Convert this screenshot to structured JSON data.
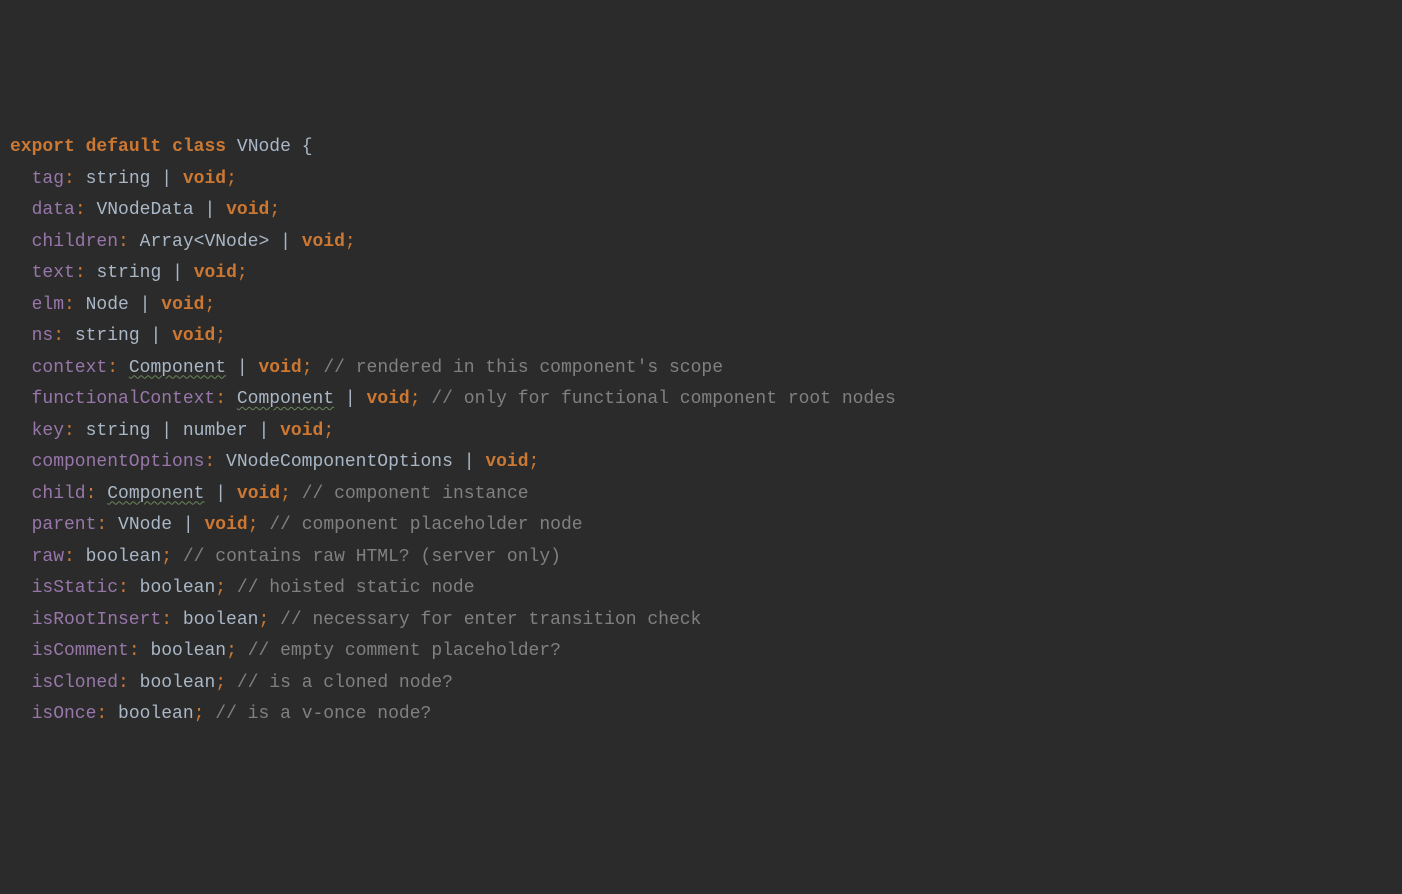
{
  "header": {
    "export": "export",
    "default": "default",
    "class": "class",
    "name": "VNode",
    "brace": "{"
  },
  "props": [
    {
      "name": "tag",
      "types": [
        "string"
      ],
      "void": true,
      "comment": "",
      "squiggle": []
    },
    {
      "name": "data",
      "types": [
        "VNodeData"
      ],
      "void": true,
      "comment": "",
      "squiggle": []
    },
    {
      "name": "children",
      "types": [
        "Array<VNode>"
      ],
      "void": true,
      "comment": "",
      "squiggle": []
    },
    {
      "name": "text",
      "types": [
        "string"
      ],
      "void": true,
      "comment": "",
      "squiggle": []
    },
    {
      "name": "elm",
      "types": [
        "Node"
      ],
      "void": true,
      "comment": "",
      "squiggle": []
    },
    {
      "name": "ns",
      "types": [
        "string"
      ],
      "void": true,
      "comment": "",
      "squiggle": []
    },
    {
      "name": "context",
      "types": [
        "Component"
      ],
      "void": true,
      "comment": "// rendered in this component's scope",
      "squiggle": [
        0
      ]
    },
    {
      "name": "functionalContext",
      "types": [
        "Component"
      ],
      "void": true,
      "comment": "// only for functional component root nodes",
      "squiggle": [
        0
      ]
    },
    {
      "name": "key",
      "types": [
        "string",
        "number"
      ],
      "void": true,
      "comment": "",
      "squiggle": []
    },
    {
      "name": "componentOptions",
      "types": [
        "VNodeComponentOptions"
      ],
      "void": true,
      "comment": "",
      "squiggle": []
    },
    {
      "name": "child",
      "types": [
        "Component"
      ],
      "void": true,
      "comment": "// component instance",
      "squiggle": [
        0
      ]
    },
    {
      "name": "parent",
      "types": [
        "VNode"
      ],
      "void": true,
      "comment": "// component placeholder node",
      "squiggle": []
    },
    {
      "name": "raw",
      "types": [
        "boolean"
      ],
      "void": false,
      "comment": "// contains raw HTML? (server only)",
      "squiggle": []
    },
    {
      "name": "isStatic",
      "types": [
        "boolean"
      ],
      "void": false,
      "comment": "// hoisted static node",
      "squiggle": []
    },
    {
      "name": "isRootInsert",
      "types": [
        "boolean"
      ],
      "void": false,
      "comment": "// necessary for enter transition check",
      "squiggle": []
    },
    {
      "name": "isComment",
      "types": [
        "boolean"
      ],
      "void": false,
      "comment": "// empty comment placeholder?",
      "squiggle": []
    },
    {
      "name": "isCloned",
      "types": [
        "boolean"
      ],
      "void": false,
      "comment": "// is a cloned node?",
      "squiggle": []
    },
    {
      "name": "isOnce",
      "types": [
        "boolean"
      ],
      "void": false,
      "comment": "// is a v-once node?",
      "squiggle": []
    }
  ]
}
